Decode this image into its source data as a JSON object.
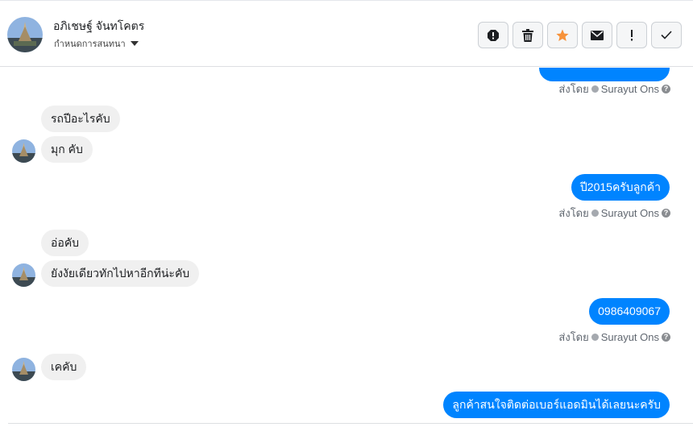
{
  "header": {
    "contact_name": "อภิเชษฐ์ จันทโคตร",
    "assign_label": "กำหนดการสนทนา"
  },
  "actions": {
    "icons": [
      "spam-icon",
      "trash-icon",
      "star-icon",
      "envelope-icon",
      "exclamation-icon",
      "check-icon"
    ],
    "star_color": "#f7923a"
  },
  "messages": [
    {
      "dir": "out",
      "text": "",
      "cut": true
    },
    {
      "dir": "meta",
      "prefix": "ส่งโดย",
      "sender": "Surayut Ons"
    },
    {
      "dir": "in",
      "text": "รถปีอะไรคับ"
    },
    {
      "dir": "in",
      "text": "มุก  คับ"
    },
    {
      "dir": "out",
      "text": "ปี2015ครับลูกค้า"
    },
    {
      "dir": "meta",
      "prefix": "ส่งโดย",
      "sender": "Surayut Ons"
    },
    {
      "dir": "in",
      "text": "อ่อคับ"
    },
    {
      "dir": "in",
      "text": "ยังงัยเดียวทักไปหาอีกทีน่ะคับ"
    },
    {
      "dir": "out",
      "text": "0986409067"
    },
    {
      "dir": "meta",
      "prefix": "ส่งโดย",
      "sender": "Surayut Ons"
    },
    {
      "dir": "in",
      "text": "เคคับ"
    },
    {
      "dir": "out",
      "text": "ลูกค้าสนใจติดต่อเบอร์แอดมินได้เลยนะครับ"
    }
  ],
  "colors": {
    "outgoing_bubble": "#0084ff",
    "incoming_bubble": "#f0f0f0"
  }
}
